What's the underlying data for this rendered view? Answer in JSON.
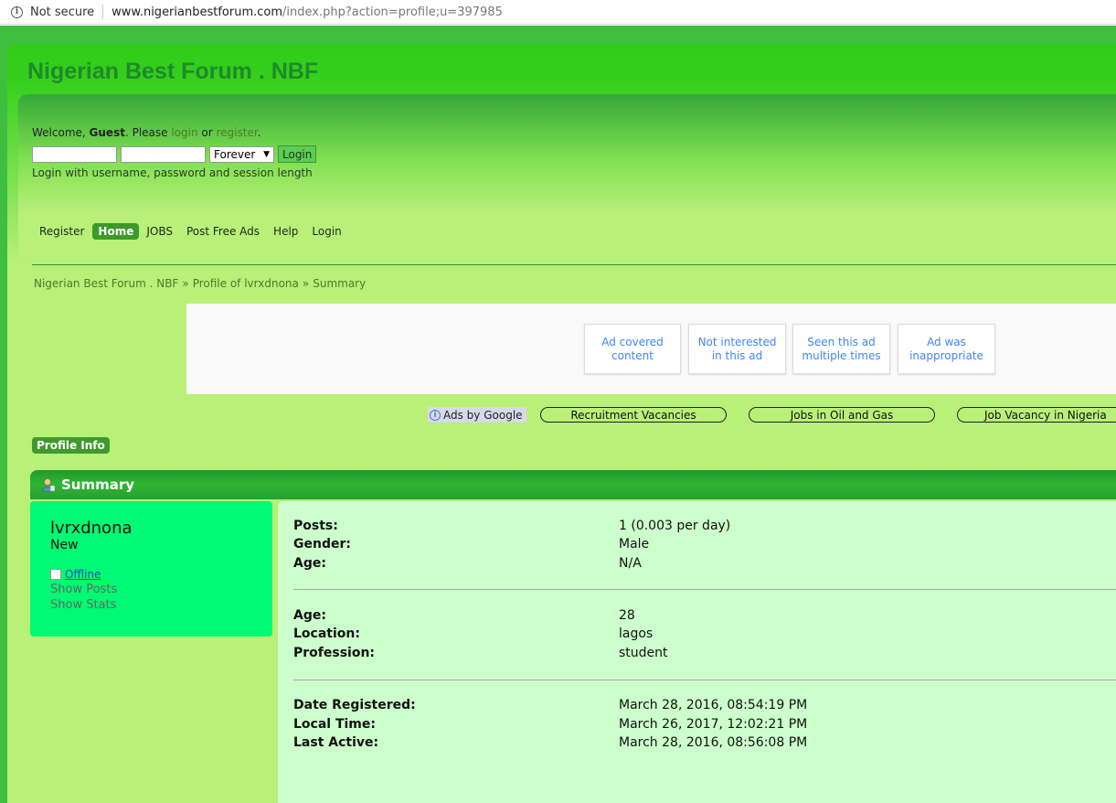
{
  "browser": {
    "security_label": "Not secure",
    "url_host": "www.nigerianbestforum.com",
    "url_path": "/index.php?action=profile;u=397985"
  },
  "site": {
    "title": "Nigerian Best Forum . NBF"
  },
  "login": {
    "welcome_prefix": "Welcome, ",
    "guest": "Guest",
    "please": ". Please ",
    "login_link": "login",
    "or": " or ",
    "register_link": "register",
    "end": ".",
    "session_option": "Forever",
    "button": "Login",
    "hint": "Login with username, password and session length"
  },
  "nav": {
    "items": [
      "Register",
      "Home",
      "JOBS",
      "Post Free Ads",
      "Help",
      "Login"
    ],
    "active": "Home"
  },
  "breadcrumb": [
    "Nigerian Best Forum . NBF",
    "Profile of lvrxdnona",
    "Summary"
  ],
  "breadcrumb_sep": "»",
  "ad_feedback": {
    "buttons": [
      [
        "Ad covered",
        "content"
      ],
      [
        "Not interested",
        "in this ad"
      ],
      [
        "Seen this ad",
        "multiple times"
      ],
      [
        "Ad was",
        "inappropriate"
      ]
    ]
  },
  "ads": {
    "label": "Ads by Google",
    "links": [
      "Recruitment Vacancies",
      "Jobs in Oil and Gas",
      "Job Vacancy in Nigeria"
    ]
  },
  "profile_tab": "Profile Info",
  "summary": {
    "title": "Summary"
  },
  "user": {
    "name": "lvrxdnona",
    "rank": "New",
    "status": "Offline",
    "show_posts": "Show Posts",
    "show_stats": "Show Stats"
  },
  "stats": {
    "group1": [
      {
        "label": "Posts:",
        "value": "1 (0.003 per day)"
      },
      {
        "label": "Gender:",
        "value": "Male"
      },
      {
        "label": "Age:",
        "value": "N/A"
      }
    ],
    "group2": [
      {
        "label": "Age:",
        "value": "28"
      },
      {
        "label": "Location:",
        "value": "lagos"
      },
      {
        "label": "Profession:",
        "value": "student"
      }
    ],
    "group3": [
      {
        "label": "Date Registered:",
        "value": "March 28, 2016, 08:54:19 PM"
      },
      {
        "label": "Local Time:",
        "value": "March 26, 2017, 12:02:21 PM"
      },
      {
        "label": "Last Active:",
        "value": "March 28, 2016, 08:56:08 PM"
      }
    ]
  },
  "colors": {
    "accent_green": "#3d9a28",
    "summary_bar": "#25a02f",
    "left_card": "#00fa73",
    "right_card": "#ccffcc",
    "page_bg": "#b8f078"
  }
}
